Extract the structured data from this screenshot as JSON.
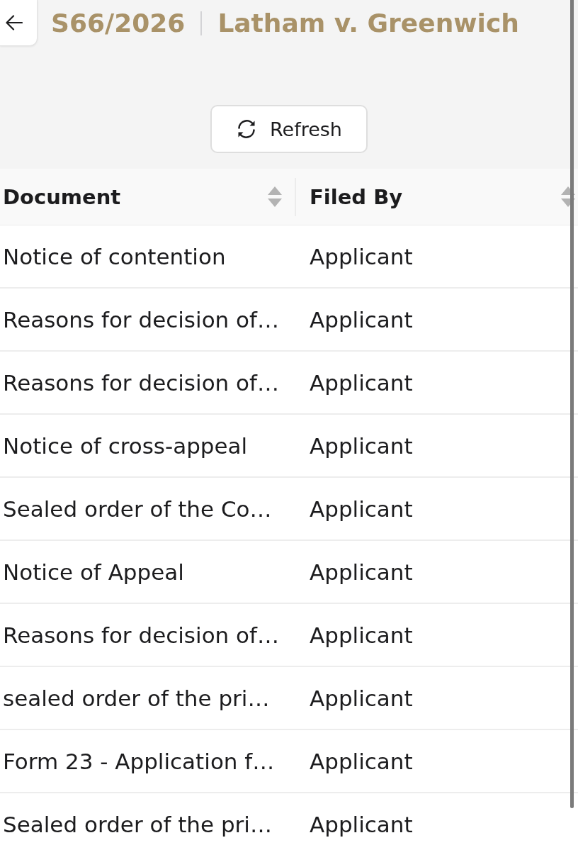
{
  "header": {
    "case_number": "S66/2026",
    "case_title": "Latham v. Greenwich"
  },
  "toolbar": {
    "refresh_button": "Refresh"
  },
  "table": {
    "columns": [
      {
        "label": "Document",
        "sortable": true
      },
      {
        "label": "Filed By",
        "sortable": true
      }
    ],
    "rows": [
      {
        "document": "Notice of contention",
        "filed_by": "Applicant"
      },
      {
        "document": "Reasons for decision of…",
        "filed_by": "Applicant"
      },
      {
        "document": "Reasons for decision of…",
        "filed_by": "Applicant"
      },
      {
        "document": "Notice of cross-appeal",
        "filed_by": "Applicant"
      },
      {
        "document": "Sealed order of the Co…",
        "filed_by": "Applicant"
      },
      {
        "document": "Notice of Appeal",
        "filed_by": "Applicant"
      },
      {
        "document": "Reasons for decision of…",
        "filed_by": "Applicant"
      },
      {
        "document": "sealed order of the pri…",
        "filed_by": "Applicant"
      },
      {
        "document": "Form 23 - Application f…",
        "filed_by": "Applicant"
      },
      {
        "document": "Sealed order of the pri…",
        "filed_by": "Applicant"
      }
    ]
  }
}
